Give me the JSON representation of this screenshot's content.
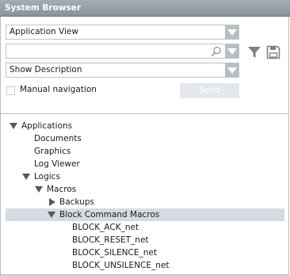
{
  "window": {
    "title": "System Browser"
  },
  "view_select": {
    "value": "Application View"
  },
  "search": {
    "value": "",
    "placeholder": ""
  },
  "description_select": {
    "value": "Show Description"
  },
  "manual_navigation": {
    "label": "Manual navigation",
    "checked": false
  },
  "send": {
    "label": "Send"
  },
  "icons": {
    "filter": "filter-icon",
    "save": "save-icon",
    "search": "search-icon"
  },
  "colors": {
    "titlebar": "#949ca5",
    "selected_row": "#d4dbe2",
    "dropdown_arrow": "#b9bec3"
  },
  "tree": [
    {
      "label": "Applications",
      "expander": "expanded"
    },
    {
      "label": "Documents",
      "expander": "none"
    },
    {
      "label": "Graphics",
      "expander": "none"
    },
    {
      "label": "Log Viewer",
      "expander": "none"
    },
    {
      "label": "Logics",
      "expander": "expanded"
    },
    {
      "label": "Macros",
      "expander": "expanded"
    },
    {
      "label": "Backups",
      "expander": "collapsed"
    },
    {
      "label": "Block Command Macros",
      "expander": "expanded",
      "selected": true
    },
    {
      "label": "BLOCK_ACK_net",
      "expander": "none"
    },
    {
      "label": "BLOCK_RESET_net",
      "expander": "none"
    },
    {
      "label": "BLOCK_SILENCE_net",
      "expander": "none"
    },
    {
      "label": "BLOCK_UNSILENCE_net",
      "expander": "none"
    }
  ]
}
